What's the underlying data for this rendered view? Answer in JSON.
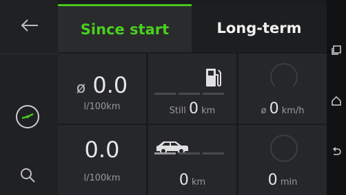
{
  "tabs": {
    "since_start": "Since start",
    "long_term": "Long-term"
  },
  "cells": {
    "consumption_avg": {
      "prefix": "ø",
      "value": "0.0",
      "unit": "l/100km"
    },
    "range": {
      "prefix": "Still",
      "value": "0",
      "unit": "km"
    },
    "speed_avg": {
      "prefix": "ø",
      "value": "0",
      "unit": "km/h"
    },
    "consumption": {
      "value": "0.0",
      "unit": "l/100km"
    },
    "distance": {
      "value": "0",
      "unit": "km"
    },
    "time": {
      "value": "0",
      "unit": "min"
    }
  },
  "colors": {
    "accent": "#47c81b",
    "background": "#1a1b1d"
  },
  "icons": [
    "back-icon",
    "trip-clock-icon",
    "search-icon",
    "fuel-pump-icon",
    "car-icon",
    "recent-apps-icon",
    "home-icon",
    "return-icon"
  ]
}
